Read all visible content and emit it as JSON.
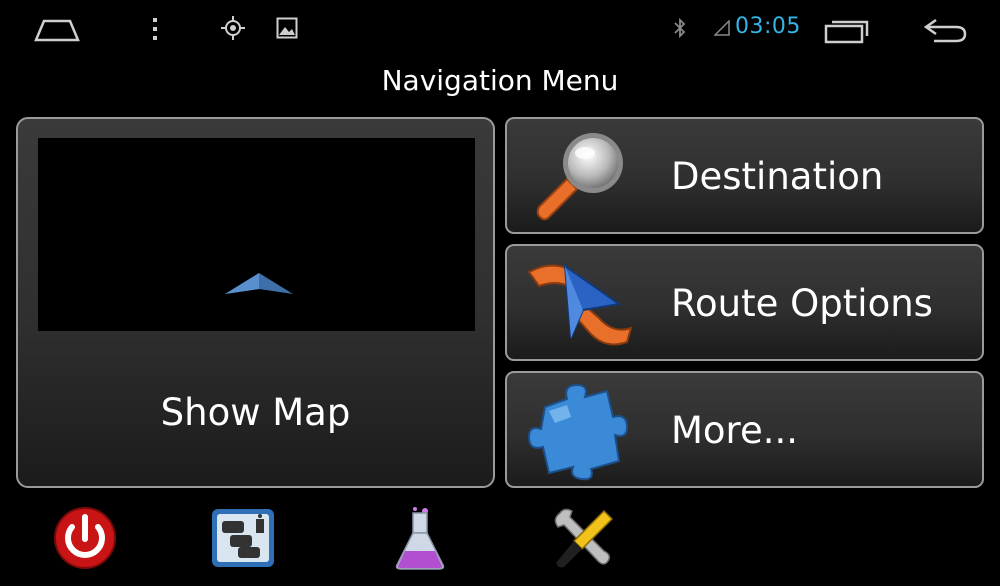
{
  "status_bar": {
    "time": "03:05",
    "time_color": "#33b5e5",
    "icons": [
      "home-icon",
      "overflow-menu-icon",
      "gps-icon",
      "gallery-icon",
      "bluetooth-icon",
      "signal-icon",
      "recent-apps-icon",
      "back-icon"
    ]
  },
  "title": "Navigation Menu",
  "map_tile": {
    "label": "Show Map",
    "icon": "position-arrow-icon"
  },
  "menu_buttons": [
    {
      "label": "Destination",
      "icon": "magnifier-icon"
    },
    {
      "label": "Route Options",
      "icon": "route-arrow-icon"
    },
    {
      "label": "More...",
      "icon": "puzzle-piece-icon"
    }
  ],
  "dock": [
    {
      "icon": "power-icon",
      "color": "#d11c1c"
    },
    {
      "icon": "traffic-info-icon",
      "color": "#2f6fb5"
    },
    {
      "icon": "flask-icon",
      "color": "#b14fd0"
    },
    {
      "icon": "tools-icon",
      "color": "#f2c21b"
    }
  ]
}
